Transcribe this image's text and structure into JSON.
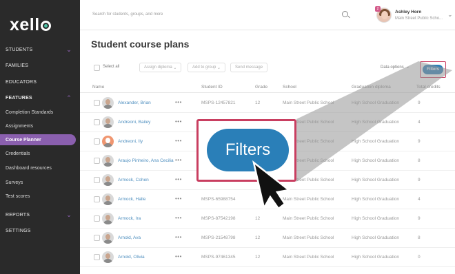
{
  "sidebar": {
    "logo": "xell",
    "items": [
      {
        "label": "STUDENTS"
      },
      {
        "label": "FAMILIES"
      },
      {
        "label": "EDUCATORS"
      },
      {
        "label": "FEATURES"
      },
      {
        "label": "Completion Standards"
      },
      {
        "label": "Assignments"
      },
      {
        "label": "Course Planner"
      },
      {
        "label": "Credentials"
      },
      {
        "label": "Dashboard resources"
      },
      {
        "label": "Surveys"
      },
      {
        "label": "Test scores"
      },
      {
        "label": "REPORTS"
      },
      {
        "label": "SETTINGS"
      }
    ],
    "accent": "#8a5fae"
  },
  "topbar": {
    "search_placeholder": "Search for students, groups, and more",
    "notification_count": "2",
    "user_name": "Ashley Horn",
    "user_school": "Main Street Public Scho..."
  },
  "main": {
    "title": "Student course plans",
    "toolbar": {
      "select_all": "Select all",
      "assign_diploma": "Assign diploma",
      "add_to_group": "Add to group",
      "send_message": "Send message",
      "data_options": "Data options",
      "filters": "Filters"
    },
    "columns": [
      "Name",
      "Student ID",
      "Grade",
      "School",
      "Graduation diploma",
      "Total credits"
    ],
    "rows": [
      {
        "name": "Alexander, Brian",
        "id": "MSPS-12457821",
        "grade": "12",
        "school": "Main Street Public School",
        "diploma": "High School Graduation",
        "credits": "9"
      },
      {
        "name": "Andreoni, Bailey",
        "id": "",
        "grade": "",
        "school": "Main Street Public School",
        "diploma": "High School Graduation",
        "credits": "4"
      },
      {
        "name": "Andreoni, Ily",
        "id": "",
        "grade": "",
        "school": "Main Street Public School",
        "diploma": "High School Graduation",
        "credits": "9"
      },
      {
        "name": "Araujo Pinheiro, Ana Cecilia",
        "id": "",
        "grade": "",
        "school": "Main Street Public School",
        "diploma": "High School Graduation",
        "credits": "8"
      },
      {
        "name": "Armock, Cohen",
        "id": "",
        "grade": "",
        "school": "Main Street Public School",
        "diploma": "High School Graduation",
        "credits": "9"
      },
      {
        "name": "Armock, Halle",
        "id": "MSPS-65988754",
        "grade": "",
        "school": "Main Street Public School",
        "diploma": "High School Graduation",
        "credits": "4"
      },
      {
        "name": "Armock, Ira",
        "id": "MSPS-87542198",
        "grade": "12",
        "school": "Main Street Public School",
        "diploma": "High School Graduation",
        "credits": "9"
      },
      {
        "name": "Arnold, Ava",
        "id": "MSPS-21548798",
        "grade": "12",
        "school": "Main Street Public School",
        "diploma": "High School Graduation",
        "credits": "8"
      },
      {
        "name": "Arnold, Olivia",
        "id": "MSPS-97461345",
        "grade": "12",
        "school": "Main Street Public School",
        "diploma": "High School Graduation",
        "credits": "0"
      }
    ]
  },
  "zoom_callout": {
    "label": "Filters",
    "highlight_color": "#c93e60",
    "button_color": "#2a7fb8"
  }
}
